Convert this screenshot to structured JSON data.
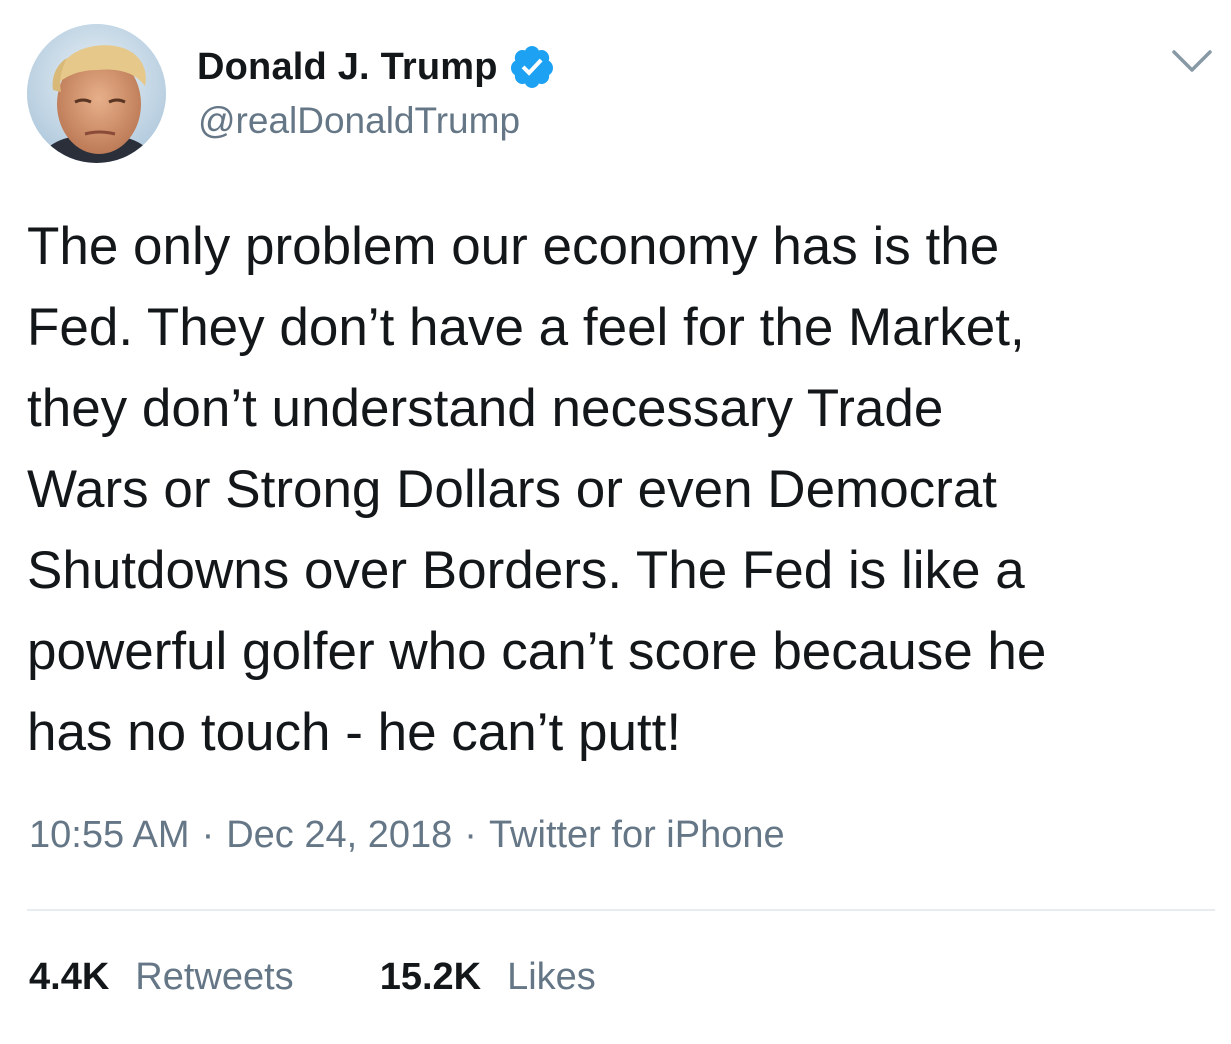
{
  "author": {
    "display_name": "Donald J. Trump",
    "handle": "@realDonaldTrump",
    "verified": true,
    "avatar_icon": "profile-photo",
    "verified_icon": "verified-badge-icon"
  },
  "tweet": {
    "text": "The only problem our economy has is the\nFed. They don’t have a feel for the Market,\nthey don’t understand necessary Trade\nWars or Strong Dollars or even Democrat\nShutdowns over Borders. The Fed is like a\npowerful golfer who can’t score because he\nhas no touch - he can’t putt!",
    "time": "10:55 AM",
    "date": "Dec 24, 2018",
    "source": "Twitter for iPhone",
    "separator": "·"
  },
  "stats": {
    "retweets_count": "4.4K",
    "retweets_label": "Retweets",
    "likes_count": "15.2K",
    "likes_label": "Likes"
  },
  "menu": {
    "caret_icon": "chevron-down-icon"
  },
  "colors": {
    "text_primary": "#14171a",
    "text_secondary": "#657786",
    "verified_blue": "#1da1f2",
    "divider": "#e6ecf0"
  }
}
